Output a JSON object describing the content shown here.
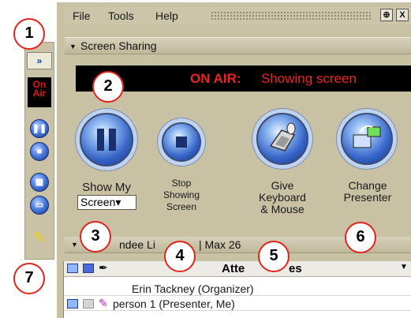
{
  "menu": {
    "file": "File",
    "tools": "Tools",
    "help": "Help",
    "pin": "⊕",
    "close": "X"
  },
  "screen_sharing": {
    "header": "Screen Sharing",
    "on_air_label": "ON AIR:",
    "on_air_status": "Showing screen",
    "show_my_line1": "Show My",
    "screen_select": "Screen▾",
    "stop_line1": "Stop",
    "stop_line2": "Showing",
    "stop_line3": "Screen",
    "give_line1": "Give",
    "give_line2": "Keyboard",
    "give_line3": "& Mouse",
    "change_line1": "Change",
    "change_line2": "Presenter"
  },
  "left_toolbar": {
    "expand": "»",
    "on_air_top": "On",
    "on_air_bottom": "Air"
  },
  "attendees": {
    "header": "ndee Li",
    "header_tail": "| Max 26",
    "column_attendees": "Atte",
    "column_attendees_tail": "es",
    "rows": [
      {
        "name": "Erin Tackney (Organizer)"
      },
      {
        "name": "person 1 (Presenter, Me)"
      }
    ]
  },
  "callouts": [
    "1",
    "2",
    "3",
    "4",
    "5",
    "6",
    "7"
  ],
  "colors": {
    "panel_bg": "#c8c1a4",
    "on_air_red": "#ef2222",
    "callout_border": "#e0241e",
    "button_blue": "#3765c8"
  },
  "icons": [
    "expand-arrow-icon",
    "on-air-icon",
    "pause-icon",
    "stop-icon",
    "grid-icon",
    "monitor-icon",
    "highlighter-icon",
    "pause-large-icon",
    "stop-large-icon",
    "keyboard-mouse-icon",
    "change-presenter-icon",
    "pin-icon",
    "close-icon",
    "attendee-monitor-icon",
    "attendee-grid-icon",
    "pen-icon"
  ]
}
